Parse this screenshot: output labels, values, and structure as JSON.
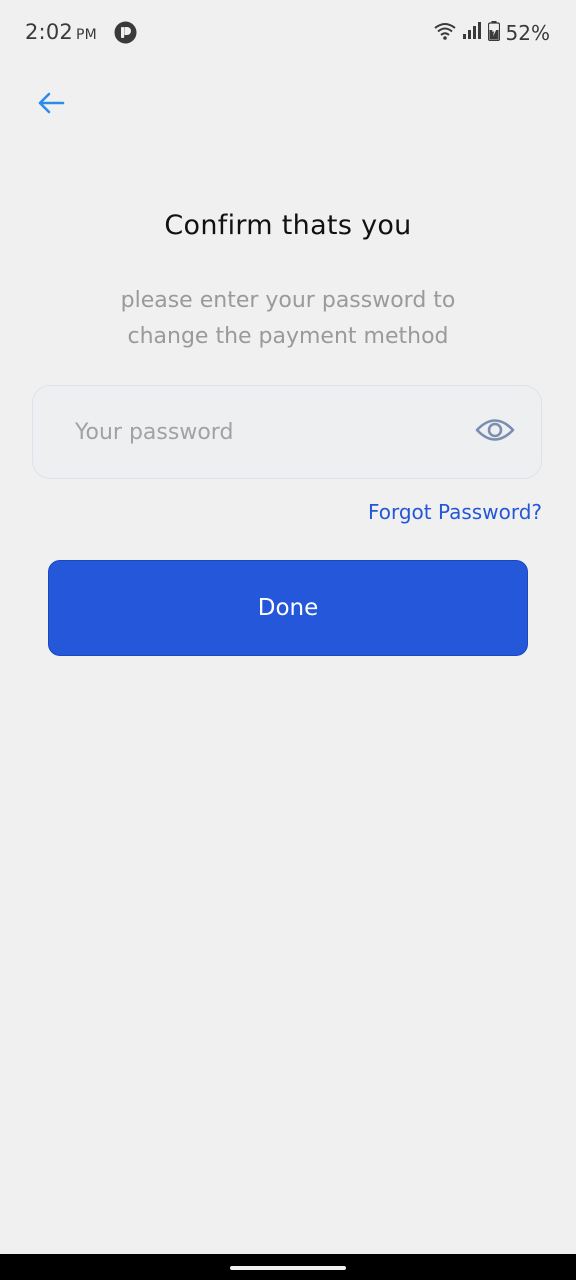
{
  "status_bar": {
    "time": "2:02",
    "ampm": "PM",
    "battery": "52%",
    "icons": [
      "app-notification-icon",
      "wifi-icon",
      "signal-icon",
      "battery-icon"
    ]
  },
  "header": {
    "back_icon": "arrow-left-icon"
  },
  "content": {
    "title": "Confirm thats you",
    "subtitle": "please enter your password to change the payment method",
    "password": {
      "placeholder": "Your password",
      "value": "",
      "toggle_icon": "eye-icon"
    },
    "forgot_label": "Forgot Password?",
    "done_label": "Done"
  },
  "colors": {
    "background": "#f0f0f1",
    "accent": "#2457d9",
    "back_arrow": "#2c8de8",
    "link": "#2457d6",
    "subtitle": "#9a9a9a",
    "eye_icon": "#7a8eb0"
  }
}
